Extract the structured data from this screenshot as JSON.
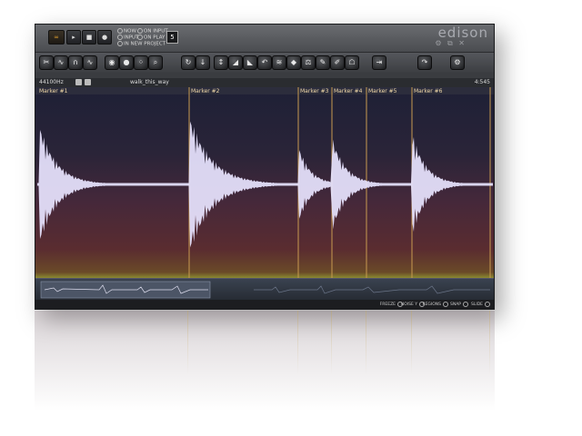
{
  "app": {
    "logo": "edison",
    "logo_icons": "⚙ ⧉ ✕"
  },
  "transport": {
    "buttons": [
      "∞",
      "▸",
      "■",
      "●"
    ]
  },
  "modes": {
    "now": "NOW",
    "on_input": "ON INPUT",
    "input": "INPUT",
    "on_play": "ON PLAY",
    "in_new_project": "IN NEW PROJECT",
    "snap_value": "5"
  },
  "toolbar_icons": [
    "scissors-icon",
    "wave-icon",
    "magnet-icon",
    "wave-icon",
    "eye-icon",
    "record-icon",
    "circle-dots-icon",
    "search-icon",
    "loop-icon",
    "download-icon",
    "normalize-icon",
    "fade-icon",
    "trim-icon",
    "undo-icon",
    "noise-icon",
    "drop-icon",
    "tune-icon",
    "pencil-icon",
    "brush-icon",
    "lock-icon",
    "export-icon",
    "redo-icon",
    "settings-icon"
  ],
  "info": {
    "samplerate": "44100Hz",
    "filename": "walk_this_way",
    "time": "4:545"
  },
  "markers": [
    {
      "label": "Marker #1"
    },
    {
      "label": "Marker #2"
    },
    {
      "label": "Marker #3"
    },
    {
      "label": "Marker #4"
    },
    {
      "label": "Marker #5"
    },
    {
      "label": "Marker #6"
    }
  ],
  "bottom_options": {
    "freeze": "FREEZE",
    "noise": "NOISE Y",
    "regions": "REGIONS",
    "snap": "SNAP",
    "slide": "SLIDE"
  },
  "colors": {
    "accent": "#e0a030",
    "wave": "#e8e4ff",
    "marker_line": "#c89a50"
  }
}
